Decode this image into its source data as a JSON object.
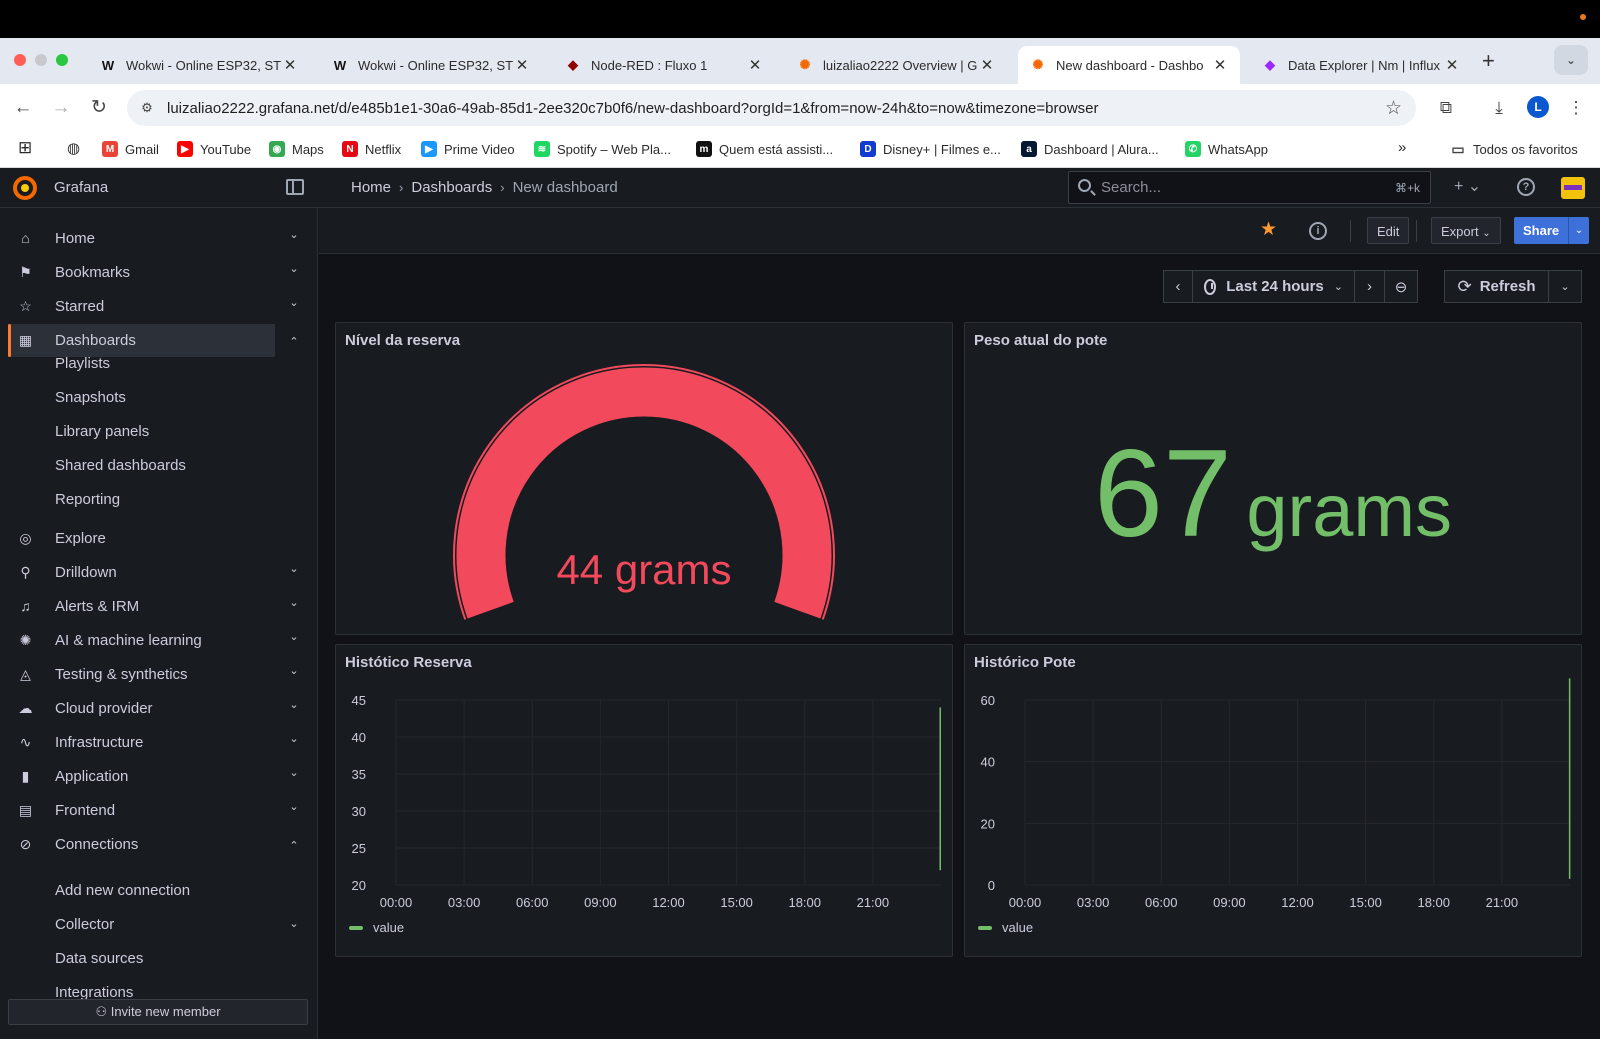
{
  "browser": {
    "tabs": [
      {
        "title": "Wokwi - Online ESP32, ST",
        "favicon": "W",
        "favicon_color": "#111111"
      },
      {
        "title": "Wokwi - Online ESP32, ST",
        "favicon": "W",
        "favicon_color": "#111111"
      },
      {
        "title": "Node-RED : Fluxo 1",
        "favicon": "node-red-icon",
        "favicon_color": "#8f0000"
      },
      {
        "title": "luizaliao2222 Overview | G",
        "favicon": "grafana-icon",
        "favicon_color": "#f46800"
      },
      {
        "title": "New dashboard - Dashbo",
        "favicon": "grafana-icon",
        "favicon_color": "#f46800"
      },
      {
        "title": "Data Explorer | Nm | Influx",
        "favicon": "influx-icon",
        "favicon_color": "#9b2aff"
      }
    ],
    "active_tab": 4,
    "url": "luizaliao2222.grafana.net/d/e485b1e1-30a6-49ab-85d1-2ee320c7b0f6/new-dashboard?orgId=1&from=now-24h&to=now&timezone=browser",
    "avatar_letter": "L",
    "bookmarks": [
      {
        "label": "Gmail",
        "icon": "gmail-icon",
        "color": "#ea4335",
        "glyph": "M"
      },
      {
        "label": "YouTube",
        "icon": "youtube-icon",
        "color": "#ff0000",
        "glyph": "▶"
      },
      {
        "label": "Maps",
        "icon": "maps-icon",
        "color": "#34a853",
        "glyph": "◉"
      },
      {
        "label": "Netflix",
        "icon": "netflix-icon",
        "color": "#e50914",
        "glyph": "N"
      },
      {
        "label": "Prime Video",
        "icon": "prime-video-icon",
        "color": "#1a98ff",
        "glyph": "▶"
      },
      {
        "label": "Spotify – Web Pla...",
        "icon": "spotify-icon",
        "color": "#1ed760",
        "glyph": "≋"
      },
      {
        "label": "Quem está assisti...",
        "icon": "max-icon",
        "color": "#111111",
        "glyph": "m"
      },
      {
        "label": "Disney+ | Filmes e...",
        "icon": "disney-icon",
        "color": "#113ccf",
        "glyph": "D"
      },
      {
        "label": "Dashboard | Alura...",
        "icon": "alura-icon",
        "color": "#051933",
        "glyph": "a"
      },
      {
        "label": "WhatsApp",
        "icon": "whatsapp-icon",
        "color": "#25d366",
        "glyph": "✆"
      }
    ],
    "all_bookmarks": "Todos os favoritos"
  },
  "grafana": {
    "brand": "Grafana",
    "breadcrumb": [
      "Home",
      "Dashboards",
      "New dashboard"
    ],
    "search_placeholder": "Search...",
    "search_shortcut": "⌘+k",
    "sidebar": {
      "items": [
        {
          "label": "Home",
          "icon": "home-icon",
          "glyph": "⌂",
          "chevron": "down"
        },
        {
          "label": "Bookmarks",
          "icon": "bookmark-icon",
          "glyph": "⚑",
          "chevron": "down"
        },
        {
          "label": "Starred",
          "icon": "star-icon",
          "glyph": "☆",
          "chevron": "down"
        },
        {
          "label": "Dashboards",
          "icon": "dashboards-icon",
          "glyph": "▦",
          "chevron": "up",
          "active": true
        }
      ],
      "dashboards_children": [
        "Playlists",
        "Snapshots",
        "Library panels",
        "Shared dashboards",
        "Reporting"
      ],
      "items2": [
        {
          "label": "Explore",
          "icon": "explore-icon",
          "glyph": "◎",
          "chevron": ""
        },
        {
          "label": "Drilldown",
          "icon": "drilldown-icon",
          "glyph": "⚲",
          "chevron": "down"
        },
        {
          "label": "Alerts & IRM",
          "icon": "bell-icon",
          "glyph": "♫",
          "chevron": "down"
        },
        {
          "label": "AI & machine learning",
          "icon": "brain-icon",
          "glyph": "✺",
          "chevron": "down"
        },
        {
          "label": "Testing & synthetics",
          "icon": "testing-icon",
          "glyph": "◬",
          "chevron": "down"
        },
        {
          "label": "Cloud provider",
          "icon": "cloud-icon",
          "glyph": "☁",
          "chevron": "down"
        },
        {
          "label": "Infrastructure",
          "icon": "heartbeat-icon",
          "glyph": "∿",
          "chevron": "down"
        },
        {
          "label": "Application",
          "icon": "bar-chart-icon",
          "glyph": "▮",
          "chevron": "down"
        },
        {
          "label": "Frontend",
          "icon": "frontend-icon",
          "glyph": "▤",
          "chevron": "down"
        },
        {
          "label": "Connections",
          "icon": "connections-icon",
          "glyph": "⊘",
          "chevron": "up"
        }
      ],
      "connections_children": [
        {
          "label": "Add new connection",
          "chevron": ""
        },
        {
          "label": "Collector",
          "chevron": "down"
        },
        {
          "label": "Data sources",
          "chevron": ""
        },
        {
          "label": "Integrations",
          "chevron": ""
        }
      ],
      "invite": "Invite new member"
    },
    "actions": {
      "edit": "Edit",
      "export": "Export",
      "share": "Share"
    },
    "time_range": "Last 24 hours",
    "refresh": "Refresh",
    "panels": {
      "gauge": {
        "title": "Nível da reserva",
        "value": "44",
        "unit": "grams",
        "color": "#f2495c"
      },
      "stat": {
        "title": "Peso atual do pote",
        "value": "67",
        "unit": "grams",
        "color": "#73bf69"
      },
      "history_reserve": {
        "title": "Histótico Reserva",
        "legend": "value"
      },
      "history_pot": {
        "title": "Histórico Pote",
        "legend": "value"
      }
    }
  },
  "chart_data": [
    {
      "type": "line",
      "title": "Histótico Reserva",
      "x_ticks": [
        "00:00",
        "03:00",
        "06:00",
        "09:00",
        "12:00",
        "15:00",
        "18:00",
        "21:00"
      ],
      "y_ticks": [
        20,
        25,
        30,
        35,
        40,
        45
      ],
      "ylim": [
        20,
        45
      ],
      "grid": true,
      "legend": "bottom-left",
      "series": [
        {
          "name": "value",
          "color": "#73bf69",
          "points": [
            [
              "23:58",
              22
            ],
            [
              "23:58",
              44
            ]
          ]
        }
      ]
    },
    {
      "type": "line",
      "title": "Histórico Pote",
      "x_ticks": [
        "00:00",
        "03:00",
        "06:00",
        "09:00",
        "12:00",
        "15:00",
        "18:00",
        "21:00"
      ],
      "y_ticks": [
        0,
        20,
        40,
        60
      ],
      "ylim": [
        0,
        60
      ],
      "grid": true,
      "legend": "bottom-left",
      "series": [
        {
          "name": "value",
          "color": "#73bf69",
          "points": [
            [
              "23:59",
              2
            ],
            [
              "23:59",
              50
            ],
            [
              "23:59",
              67
            ]
          ]
        }
      ]
    }
  ]
}
